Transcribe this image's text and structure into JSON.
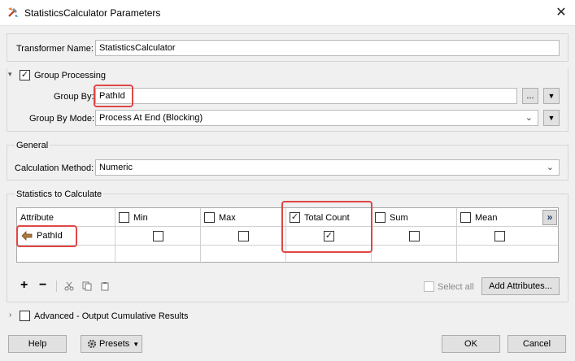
{
  "window": {
    "title": "StatisticsCalculator Parameters",
    "close_glyph": "✕"
  },
  "transformer": {
    "label": "Transformer Name:",
    "value": "StatisticsCalculator"
  },
  "group_processing": {
    "label": "Group Processing",
    "checked": true,
    "group_by_label": "Group By:",
    "group_by_value": "PathId",
    "ellipsis": "...",
    "mode_label": "Group By Mode:",
    "mode_value": "Process At End (Blocking)"
  },
  "general": {
    "title": "General",
    "calc_label": "Calculation Method:",
    "calc_value": "Numeric"
  },
  "stats": {
    "title": "Statistics to Calculate",
    "columns": [
      "Attribute",
      "Min",
      "Max",
      "Total Count",
      "Sum",
      "Mean"
    ],
    "header_checked": [
      false,
      false,
      true,
      false,
      false
    ],
    "row_attribute": "PathId",
    "row_checked": [
      false,
      false,
      true,
      false,
      false
    ],
    "more_glyph": "»"
  },
  "toolbar": {
    "add": "+",
    "remove": "−",
    "select_all": "Select all",
    "add_attributes": "Add Attributes..."
  },
  "advanced": {
    "label": "Advanced - Output Cumulative Results"
  },
  "footer": {
    "help": "Help",
    "presets": "Presets",
    "ok": "OK",
    "cancel": "Cancel"
  },
  "colors": {
    "highlight": "#e04646",
    "attr_icon": "#b07a3c"
  }
}
